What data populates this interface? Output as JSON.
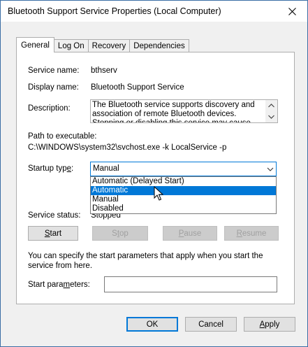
{
  "window": {
    "title": "Bluetooth Support Service Properties (Local Computer)"
  },
  "tabs": [
    {
      "label": "General",
      "active": true
    },
    {
      "label": "Log On",
      "active": false
    },
    {
      "label": "Recovery",
      "active": false
    },
    {
      "label": "Dependencies",
      "active": false
    }
  ],
  "general": {
    "service_name_label": "Service name:",
    "service_name": "bthserv",
    "display_name_label": "Display name:",
    "display_name": "Bluetooth Support Service",
    "description_label": "Description:",
    "description": "The Bluetooth service supports discovery and association of remote Bluetooth devices.  Stopping or disabling this service may cause already installed",
    "path_label": "Path to executable:",
    "path": "C:\\WINDOWS\\system32\\svchost.exe -k LocalService -p",
    "startup_type_label_pre": "Startup typ",
    "startup_type_label_u": "e",
    "startup_type_label_post": ":",
    "startup_type_value": "Manual",
    "startup_options": [
      {
        "label": "Automatic (Delayed Start)",
        "selected": false
      },
      {
        "label": "Automatic",
        "selected": true
      },
      {
        "label": "Manual",
        "selected": false
      },
      {
        "label": "Disabled",
        "selected": false
      }
    ],
    "service_status_label": "Service status:",
    "service_status": "Stopped",
    "buttons": {
      "start_u": "S",
      "start_rest": "tart",
      "stop_pre": "S",
      "stop_u": "t",
      "stop_rest": "op",
      "pause_u": "P",
      "pause_rest": "ause",
      "resume_u": "R",
      "resume_rest": "esume"
    },
    "hint": "You can specify the start parameters that apply when you start the service from here.",
    "start_params_label_pre": "Start para",
    "start_params_label_u": "m",
    "start_params_label_post": "eters:",
    "start_params_value": ""
  },
  "footer": {
    "ok": "OK",
    "cancel": "Cancel",
    "apply_u": "A",
    "apply_rest": "pply"
  },
  "colors": {
    "accent": "#0078d7",
    "disabled_text": "#a0a0a0"
  }
}
